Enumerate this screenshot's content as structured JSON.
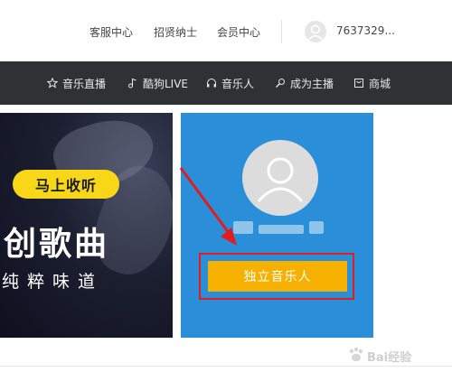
{
  "header": {
    "links": [
      "客服中心",
      "招贤纳士",
      "会员中心"
    ],
    "username": "7637329..."
  },
  "nav": {
    "items": [
      {
        "label": "音乐直播",
        "icon": "star-icon"
      },
      {
        "label": "酷狗LIVE",
        "icon": "music-note-icon"
      },
      {
        "label": "音乐人",
        "icon": "headphones-icon"
      },
      {
        "label": "成为主播",
        "icon": "microphone-icon"
      },
      {
        "label": "商城",
        "icon": "store-icon"
      }
    ]
  },
  "banner": {
    "pill": "马上收听",
    "title": "创歌曲",
    "subtitle": "纯粹味道"
  },
  "profile_card": {
    "button_label": "独立音乐人",
    "highlight_color": "#e11d1d",
    "button_color": "#f5b000"
  },
  "watermark": {
    "text": "Bai经验"
  }
}
